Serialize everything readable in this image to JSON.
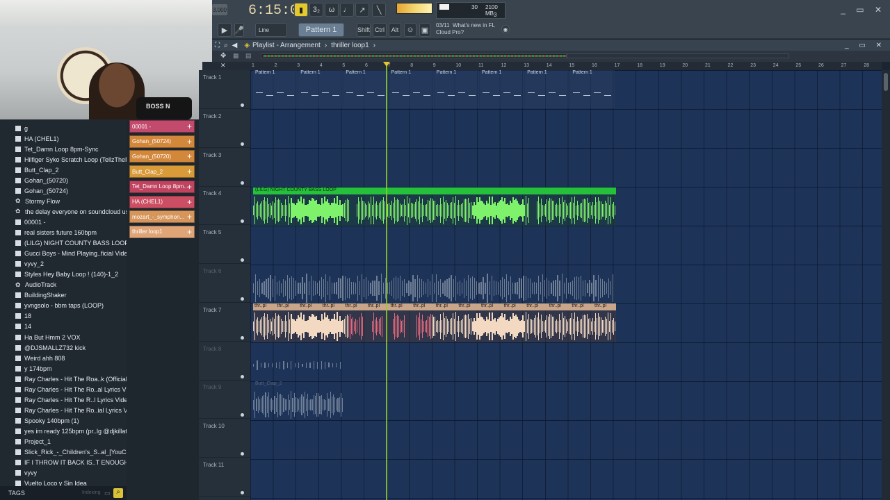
{
  "topbar": {
    "tempo_label": "3.000",
    "time": "6:15:09",
    "snap_mode": "Line",
    "pattern": "Pattern 1",
    "modifiers": [
      "Shift",
      "Ctrl",
      "Alt"
    ],
    "cpu_value": "30",
    "memory": "2100 MB",
    "voices": "3",
    "news_date": "03/11",
    "news_title": "What's new in FL",
    "news_sub": "Cloud Pro?"
  },
  "playlist": {
    "title": "Playlist - Arrangement",
    "arrangement": "thriller loop1",
    "ruler_marks": [
      "1",
      "2",
      "3",
      "4",
      "5",
      "6",
      "7",
      "8",
      "9",
      "10",
      "11",
      "12",
      "13",
      "14",
      "15",
      "16",
      "17",
      "18",
      "19",
      "20",
      "21",
      "22",
      "23",
      "24",
      "25",
      "26",
      "27",
      "28"
    ]
  },
  "webcam": {
    "chair_text": "BOSS N"
  },
  "browser": {
    "items": [
      {
        "label": "g",
        "icon": "file-icon"
      },
      {
        "label": "HA (CHEL1)",
        "icon": "file-icon"
      },
      {
        "label": "Tet_Damn Loop 8pm-Sync",
        "icon": "file-icon"
      },
      {
        "label": "Hilfiger Syko Scratch Loop (TellzTheProducer)_2",
        "icon": "file-icon"
      },
      {
        "label": "Butt_Clap_2",
        "icon": "file-icon"
      },
      {
        "label": "Gohan_(50720)",
        "icon": "file-icon"
      },
      {
        "label": "Gohan_(50724)",
        "icon": "file-icon"
      },
      {
        "label": "Stormy Flow",
        "icon": "gear-icon"
      },
      {
        "label": "the delay everyone on soundcloud uses",
        "icon": "gear-icon"
      },
      {
        "label": "00001 -",
        "icon": "file-icon"
      },
      {
        "label": "real sisters future 160bpm",
        "icon": "file-icon"
      },
      {
        "label": "(LILG) NIGHT COUNTY BASS LOOP",
        "icon": "file-icon"
      },
      {
        "label": "Gucci Boys - Mind Playing..ficial Video) [Explicit]",
        "icon": "file-icon"
      },
      {
        "label": "vyvy_2",
        "icon": "file-icon"
      },
      {
        "label": "Styles Hey Baby Loop ! (140)-1_2",
        "icon": "file-icon"
      },
      {
        "label": "AudioTrack",
        "icon": "gear-icon"
      },
      {
        "label": "BuildingShaker",
        "icon": "file-icon"
      },
      {
        "label": "yvngsolo - bbm taps (LOOP)",
        "icon": "file-icon"
      },
      {
        "label": "18",
        "icon": "file-icon"
      },
      {
        "label": "14",
        "icon": "file-icon"
      },
      {
        "label": "Ha But Hmm 2 VOX",
        "icon": "file-icon"
      },
      {
        "label": "@DJSMALLZ732 kick",
        "icon": "file-icon"
      },
      {
        "label": "Weird ahh 808",
        "icon": "file-icon"
      },
      {
        "label": "y 174bpm",
        "icon": "file-icon"
      },
      {
        "label": "Ray Charles - Hit The Roa..k (Official Lyrics Video)",
        "icon": "file-icon"
      },
      {
        "label": "Ray Charles - Hit The Ro..al Lyrics Video) [vocals]",
        "icon": "file-icon"
      },
      {
        "label": "Ray Charles - Hit The R..l Lyrics Video) [drums]",
        "icon": "file-icon"
      },
      {
        "label": "Ray Charles - Hit The Ro..ial Lyrics Video) [music]",
        "icon": "file-icon"
      },
      {
        "label": "Spooky 140bpm (1)",
        "icon": "file-icon"
      },
      {
        "label": "yes im ready 125bpm (pr..lg @djkillathebeatplug",
        "icon": "file-icon"
      },
      {
        "label": "Project_1",
        "icon": "file-icon"
      },
      {
        "label": "Slick_Rick_-_Children's_S..al_[YouConvert.net] (1)",
        "icon": "file-icon"
      },
      {
        "label": "IF I THROW IT BACK IS..T ENOUGH_(Vocals) - 160",
        "icon": "file-icon"
      },
      {
        "label": "vyvy",
        "icon": "file-icon"
      },
      {
        "label": "Vuelto Loco y Sin Idea",
        "icon": "file-icon"
      }
    ],
    "footer_label": "TAGS",
    "footer_status": "Indexing"
  },
  "channels": [
    {
      "label": "00001 -",
      "color": "#c24a6c"
    },
    {
      "label": "Gohan_(50724)",
      "color": "#d2873b"
    },
    {
      "label": "Gohan_(50720)",
      "color": "#d2873b"
    },
    {
      "label": "Butt_Clap_2",
      "color": "#d99a3a"
    },
    {
      "label": "Tet_Damn Loop 8pm...",
      "color": "#c0445f"
    },
    {
      "label": "HA (CHEL1)",
      "color": "#cc4e63"
    },
    {
      "label": "mozart_-_symphon...",
      "color": "#d6955a"
    },
    {
      "label": "thriller loop1",
      "color": "#e0a577"
    }
  ],
  "tracks": [
    {
      "label": "Track 1",
      "muted": false
    },
    {
      "label": "Track 2",
      "muted": false
    },
    {
      "label": "Track 3",
      "muted": false
    },
    {
      "label": "Track 4",
      "muted": false
    },
    {
      "label": "Track 5",
      "muted": false
    },
    {
      "label": "Track 6",
      "muted": true
    },
    {
      "label": "Track 7",
      "muted": false
    },
    {
      "label": "Track 8",
      "muted": true
    },
    {
      "label": "Track 9",
      "muted": true
    },
    {
      "label": "Track 10",
      "muted": false
    },
    {
      "label": "Track 11",
      "muted": false
    }
  ],
  "clips": {
    "pattern_label": "Pattern 1",
    "bass_label": "(LILG) NIGHT COUNTY BASS LOOP",
    "thriller_label": "thr..pl",
    "butt_label": "Butt_Clap_2"
  },
  "colors": {
    "bass": "#7ef26a",
    "thriller": "#f4d9c2",
    "thriller_red": "#e86a7e",
    "muted": "#6f7f96"
  }
}
